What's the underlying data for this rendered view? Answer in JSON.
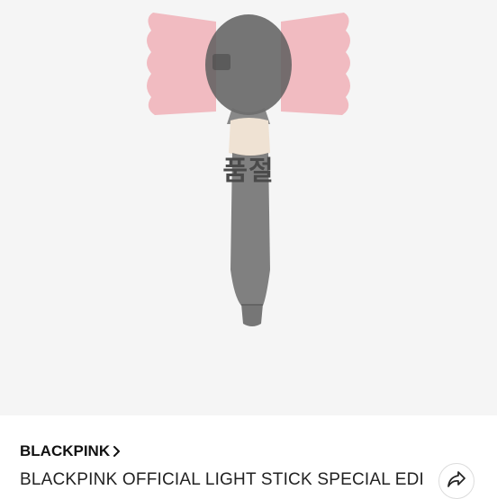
{
  "product": {
    "status_overlay": "품절",
    "brand": "BLACKPINK",
    "title": "BLACKPINK OFFICIAL LIGHT STICK SPECIAL EDI"
  },
  "icons": {
    "brand_chevron": "chevron-right-icon",
    "share": "share-icon"
  },
  "colors": {
    "image_background": "#f5f5f5",
    "lightstick_pink": "#f4a9b0",
    "lightstick_body": "#7a7a7a",
    "text_primary": "#111111"
  }
}
